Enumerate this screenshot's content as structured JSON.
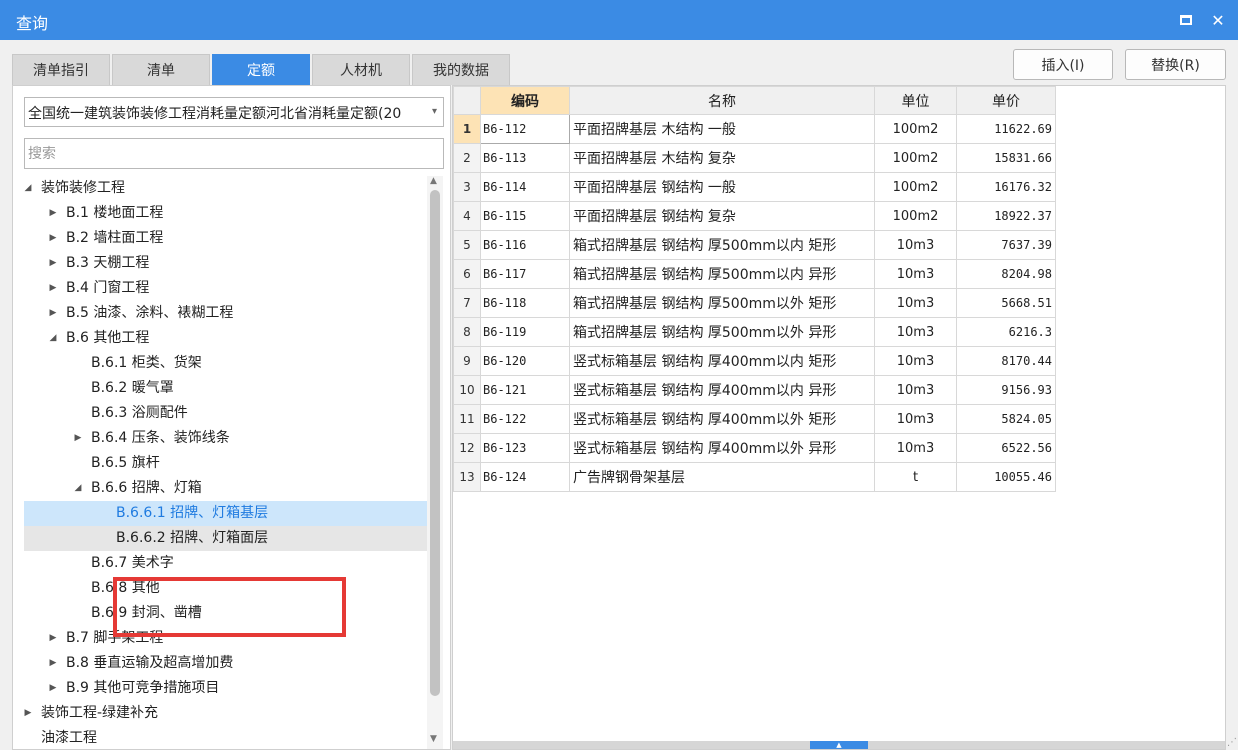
{
  "window": {
    "title": "查询",
    "maximize_icon": "maximize-icon",
    "close_icon": "close-icon",
    "close_glyph": "✕"
  },
  "tabs": [
    {
      "label": "清单指引",
      "active": false
    },
    {
      "label": "清单",
      "active": false
    },
    {
      "label": "定额",
      "active": true
    },
    {
      "label": "人材机",
      "active": false
    },
    {
      "label": "我的数据",
      "active": false
    }
  ],
  "buttons": {
    "insert": "插入(I)",
    "replace": "替换(R)"
  },
  "quota_select": {
    "value": "全国统一建筑装饰装修工程消耗量定额河北省消耗量定额(20",
    "caret": "▾"
  },
  "search": {
    "placeholder": "搜索",
    "value": ""
  },
  "tree": [
    {
      "label": "装饰装修工程",
      "level": 0,
      "arrow": "◢"
    },
    {
      "label": "B.1 楼地面工程",
      "level": 1,
      "arrow": "▶"
    },
    {
      "label": "B.2 墙柱面工程",
      "level": 1,
      "arrow": "▶"
    },
    {
      "label": "B.3 天棚工程",
      "level": 1,
      "arrow": "▶"
    },
    {
      "label": "B.4 门窗工程",
      "level": 1,
      "arrow": "▶"
    },
    {
      "label": "B.5 油漆、涂料、裱糊工程",
      "level": 1,
      "arrow": "▶"
    },
    {
      "label": "B.6 其他工程",
      "level": 1,
      "arrow": "◢"
    },
    {
      "label": "B.6.1 柜类、货架",
      "level": 2,
      "arrow": ""
    },
    {
      "label": "B.6.2 暖气罩",
      "level": 2,
      "arrow": ""
    },
    {
      "label": "B.6.3 浴厕配件",
      "level": 2,
      "arrow": ""
    },
    {
      "label": "B.6.4 压条、装饰线条",
      "level": 2,
      "arrow": "▶"
    },
    {
      "label": "B.6.5 旗杆",
      "level": 2,
      "arrow": ""
    },
    {
      "label": "B.6.6 招牌、灯箱",
      "level": 2,
      "arrow": "◢"
    },
    {
      "label": "B.6.6.1 招牌、灯箱基层",
      "level": 3,
      "arrow": "",
      "state": "selected"
    },
    {
      "label": "B.6.6.2 招牌、灯箱面层",
      "level": 3,
      "arrow": "",
      "state": "highlight"
    },
    {
      "label": "B.6.7 美术字",
      "level": 2,
      "arrow": ""
    },
    {
      "label": "B.6.8 其他",
      "level": 2,
      "arrow": ""
    },
    {
      "label": "B.6.9 封洞、凿槽",
      "level": 2,
      "arrow": ""
    },
    {
      "label": "B.7 脚手架工程",
      "level": 1,
      "arrow": "▶"
    },
    {
      "label": "B.8 垂直运输及超高增加费",
      "level": 1,
      "arrow": "▶"
    },
    {
      "label": "B.9 其他可竞争措施项目",
      "level": 1,
      "arrow": "▶"
    },
    {
      "label": "装饰工程-绿建补充",
      "level": 0,
      "arrow": "▶"
    },
    {
      "label": "油漆工程",
      "level": 0,
      "arrow": ""
    }
  ],
  "scroll_glyphs": {
    "up": "▲",
    "down": "▼",
    "hscroll_handle": "▲",
    "resize_grip": "⋰"
  },
  "table": {
    "columns": [
      "编码",
      "名称",
      "单位",
      "单价"
    ],
    "rows": [
      {
        "no": "1",
        "code": "B6-112",
        "name": "平面招牌基层 木结构 一般",
        "unit": "100m2",
        "price": "11622.69"
      },
      {
        "no": "2",
        "code": "B6-113",
        "name": "平面招牌基层 木结构 复杂",
        "unit": "100m2",
        "price": "15831.66"
      },
      {
        "no": "3",
        "code": "B6-114",
        "name": "平面招牌基层 钢结构 一般",
        "unit": "100m2",
        "price": "16176.32"
      },
      {
        "no": "4",
        "code": "B6-115",
        "name": "平面招牌基层 钢结构 复杂",
        "unit": "100m2",
        "price": "18922.37"
      },
      {
        "no": "5",
        "code": "B6-116",
        "name": "箱式招牌基层 钢结构 厚500mm以内 矩形",
        "unit": "10m3",
        "price": "7637.39"
      },
      {
        "no": "6",
        "code": "B6-117",
        "name": "箱式招牌基层 钢结构 厚500mm以内 异形",
        "unit": "10m3",
        "price": "8204.98"
      },
      {
        "no": "7",
        "code": "B6-118",
        "name": "箱式招牌基层 钢结构 厚500mm以外 矩形",
        "unit": "10m3",
        "price": "5668.51"
      },
      {
        "no": "8",
        "code": "B6-119",
        "name": "箱式招牌基层 钢结构 厚500mm以外 异形",
        "unit": "10m3",
        "price": "6216.3"
      },
      {
        "no": "9",
        "code": "B6-120",
        "name": "竖式标箱基层 钢结构 厚400mm以内 矩形",
        "unit": "10m3",
        "price": "8170.44"
      },
      {
        "no": "10",
        "code": "B6-121",
        "name": "竖式标箱基层 钢结构 厚400mm以内 异形",
        "unit": "10m3",
        "price": "9156.93"
      },
      {
        "no": "11",
        "code": "B6-122",
        "name": "竖式标箱基层 钢结构 厚400mm以外 矩形",
        "unit": "10m3",
        "price": "5824.05"
      },
      {
        "no": "12",
        "code": "B6-123",
        "name": "竖式标箱基层 钢结构 厚400mm以外 异形",
        "unit": "10m3",
        "price": "6522.56"
      },
      {
        "no": "13",
        "code": "B6-124",
        "name": "广告牌钢骨架基层",
        "unit": "t",
        "price": "10055.46"
      }
    ]
  },
  "colors": {
    "accent": "#3b8be4",
    "selected_row": "#cde6fb",
    "active_header": "#fde3b5",
    "callout_border": "#e53935"
  }
}
